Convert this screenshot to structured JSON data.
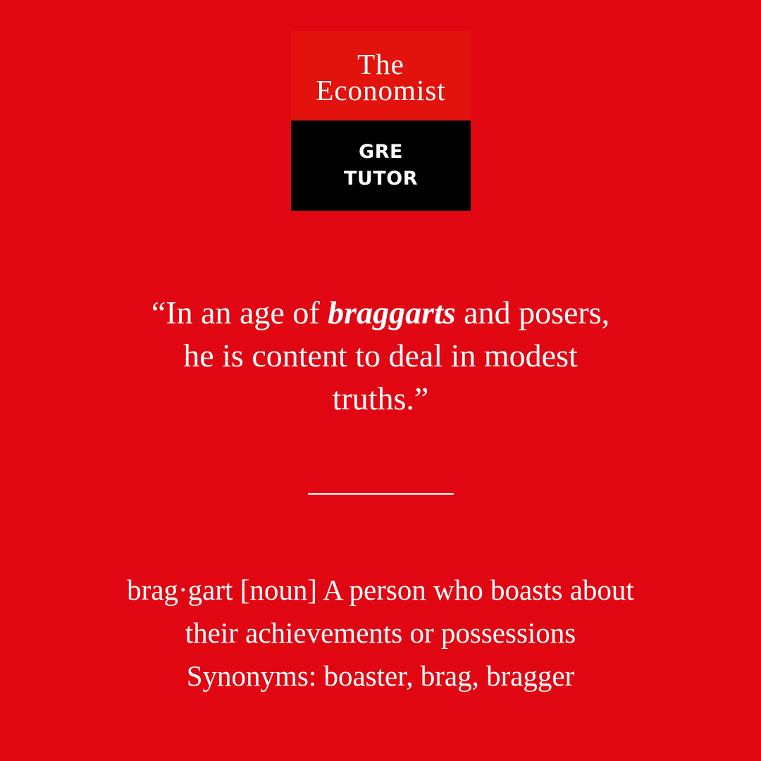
{
  "colors": {
    "background": "#e00713",
    "logo_top": "#e2120c",
    "logo_bottom": "#000000",
    "text": "#ffffff"
  },
  "logo": {
    "brand_line1": "The",
    "brand_line2": "Economist",
    "badge_line1": "GRE",
    "badge_line2": "TUTOR"
  },
  "quote": {
    "open": "“In an age of ",
    "keyword": "braggarts",
    "rest_line1": " and posers,",
    "line2": "he is content to deal in modest",
    "line3": "truths.”"
  },
  "definition": {
    "line1": "brag·gart [noun] A person who boasts about",
    "line2": "their achievements or possessions",
    "synonyms": "Synonyms: boaster, brag, bragger"
  }
}
